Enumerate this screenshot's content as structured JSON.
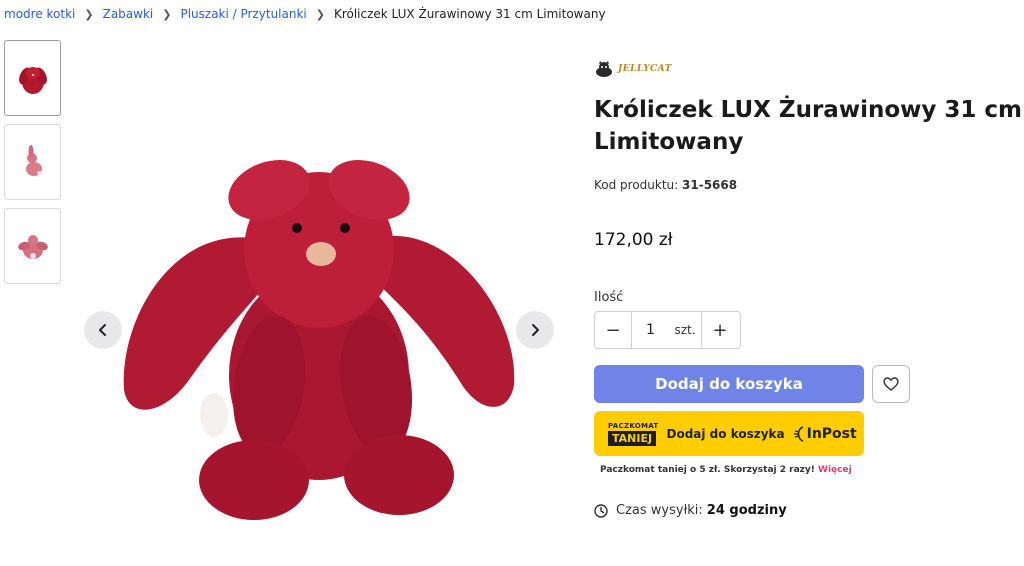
{
  "breadcrumb": {
    "items": [
      "modre kotki",
      "Zabawki",
      "Pluszaki / Przytulanki"
    ],
    "current": "Króliczek LUX Żurawinowy 31 cm Limitowany"
  },
  "brand": {
    "name": "JELLYCAT"
  },
  "product": {
    "title": "Króliczek LUX Żurawinowy 31 cm Limitowany",
    "code_label": "Kod produktu:",
    "code": "31-5668",
    "price": "172,00 zł"
  },
  "quantity": {
    "label": "Ilość",
    "value": "1",
    "unit": "szt.",
    "minus": "−",
    "plus": "+"
  },
  "cart": {
    "add_label": "Dodaj do koszyka"
  },
  "inpost": {
    "badge_top": "PACZKOMAT",
    "badge_bottom": "TANIEJ",
    "label": "Dodaj do koszyka",
    "brand": "InPost"
  },
  "promo": {
    "text": "Paczkomat taniej o 5 zł. Skorzystaj 2 razy!",
    "link": "Więcej"
  },
  "shipping": {
    "label": "Czas wysyłki:",
    "value": "24 godziny"
  },
  "colors": {
    "accent": "#6f84e6",
    "inpost": "#ffcd00",
    "link": "#2a5bd7",
    "promo_link": "#e23b7b",
    "plush": "#b3182f"
  },
  "icons": [
    "chevron-left-icon",
    "chevron-right-icon",
    "heart-icon",
    "clock-icon"
  ]
}
